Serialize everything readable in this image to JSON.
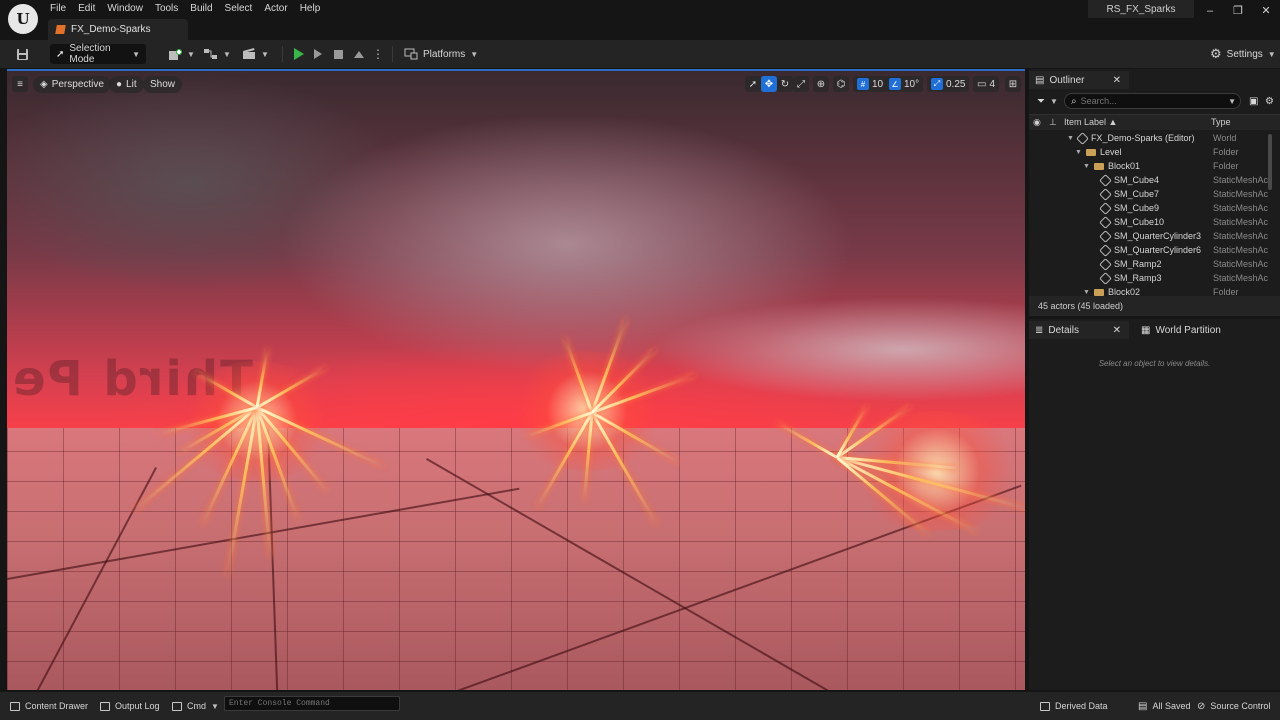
{
  "app": {
    "logo": "U",
    "menu": [
      "File",
      "Edit",
      "Window",
      "Tools",
      "Build",
      "Select",
      "Actor",
      "Help"
    ],
    "document_tab": "FX_Demo-Sparks",
    "project_name": "RS_FX_Sparks",
    "window_controls": {
      "minimize": "–",
      "maximize": "❐",
      "close": "✕"
    }
  },
  "toolbar": {
    "selection_mode": "Selection Mode",
    "platforms": "Platforms",
    "settings": "Settings"
  },
  "viewport": {
    "perspective": "Perspective",
    "lit": "Lit",
    "show": "Show",
    "grid_snap": "10",
    "rotation_snap": "10°",
    "scale_snap": "0.25",
    "camera_speed": "4",
    "watermark": "Third Pe"
  },
  "outliner": {
    "title": "Outliner",
    "search_placeholder": "Search...",
    "col_label": "Item Label ▲",
    "col_type": "Type",
    "rows": [
      {
        "label": "FX_Demo-Sparks (Editor)",
        "type": "World"
      },
      {
        "label": "Level",
        "type": "Folder"
      },
      {
        "label": "Block01",
        "type": "Folder"
      },
      {
        "label": "SM_Cube4",
        "type": "StaticMeshAc"
      },
      {
        "label": "SM_Cube7",
        "type": "StaticMeshAc"
      },
      {
        "label": "SM_Cube9",
        "type": "StaticMeshAc"
      },
      {
        "label": "SM_Cube10",
        "type": "StaticMeshAc"
      },
      {
        "label": "SM_QuarterCylinder3",
        "type": "StaticMeshAc"
      },
      {
        "label": "SM_QuarterCylinder6",
        "type": "StaticMeshAc"
      },
      {
        "label": "SM_Ramp2",
        "type": "StaticMeshAc"
      },
      {
        "label": "SM_Ramp3",
        "type": "StaticMeshAc"
      },
      {
        "label": "Block02",
        "type": "Folder"
      }
    ],
    "actor_count": "45 actors (45 loaded)"
  },
  "details": {
    "title": "Details",
    "world_partition": "World Partition",
    "hint": "Select an object to view details."
  },
  "bottom": {
    "content_drawer": "Content Drawer",
    "output_log": "Output Log",
    "cmd": "Cmd",
    "console_placeholder": "Enter Console Command",
    "derived_data": "Derived Data",
    "all_saved": "All Saved",
    "source_control": "Source Control"
  },
  "colors": {
    "accent": "#1f6fd6",
    "play": "#39b54a",
    "folder": "#c9a055"
  }
}
